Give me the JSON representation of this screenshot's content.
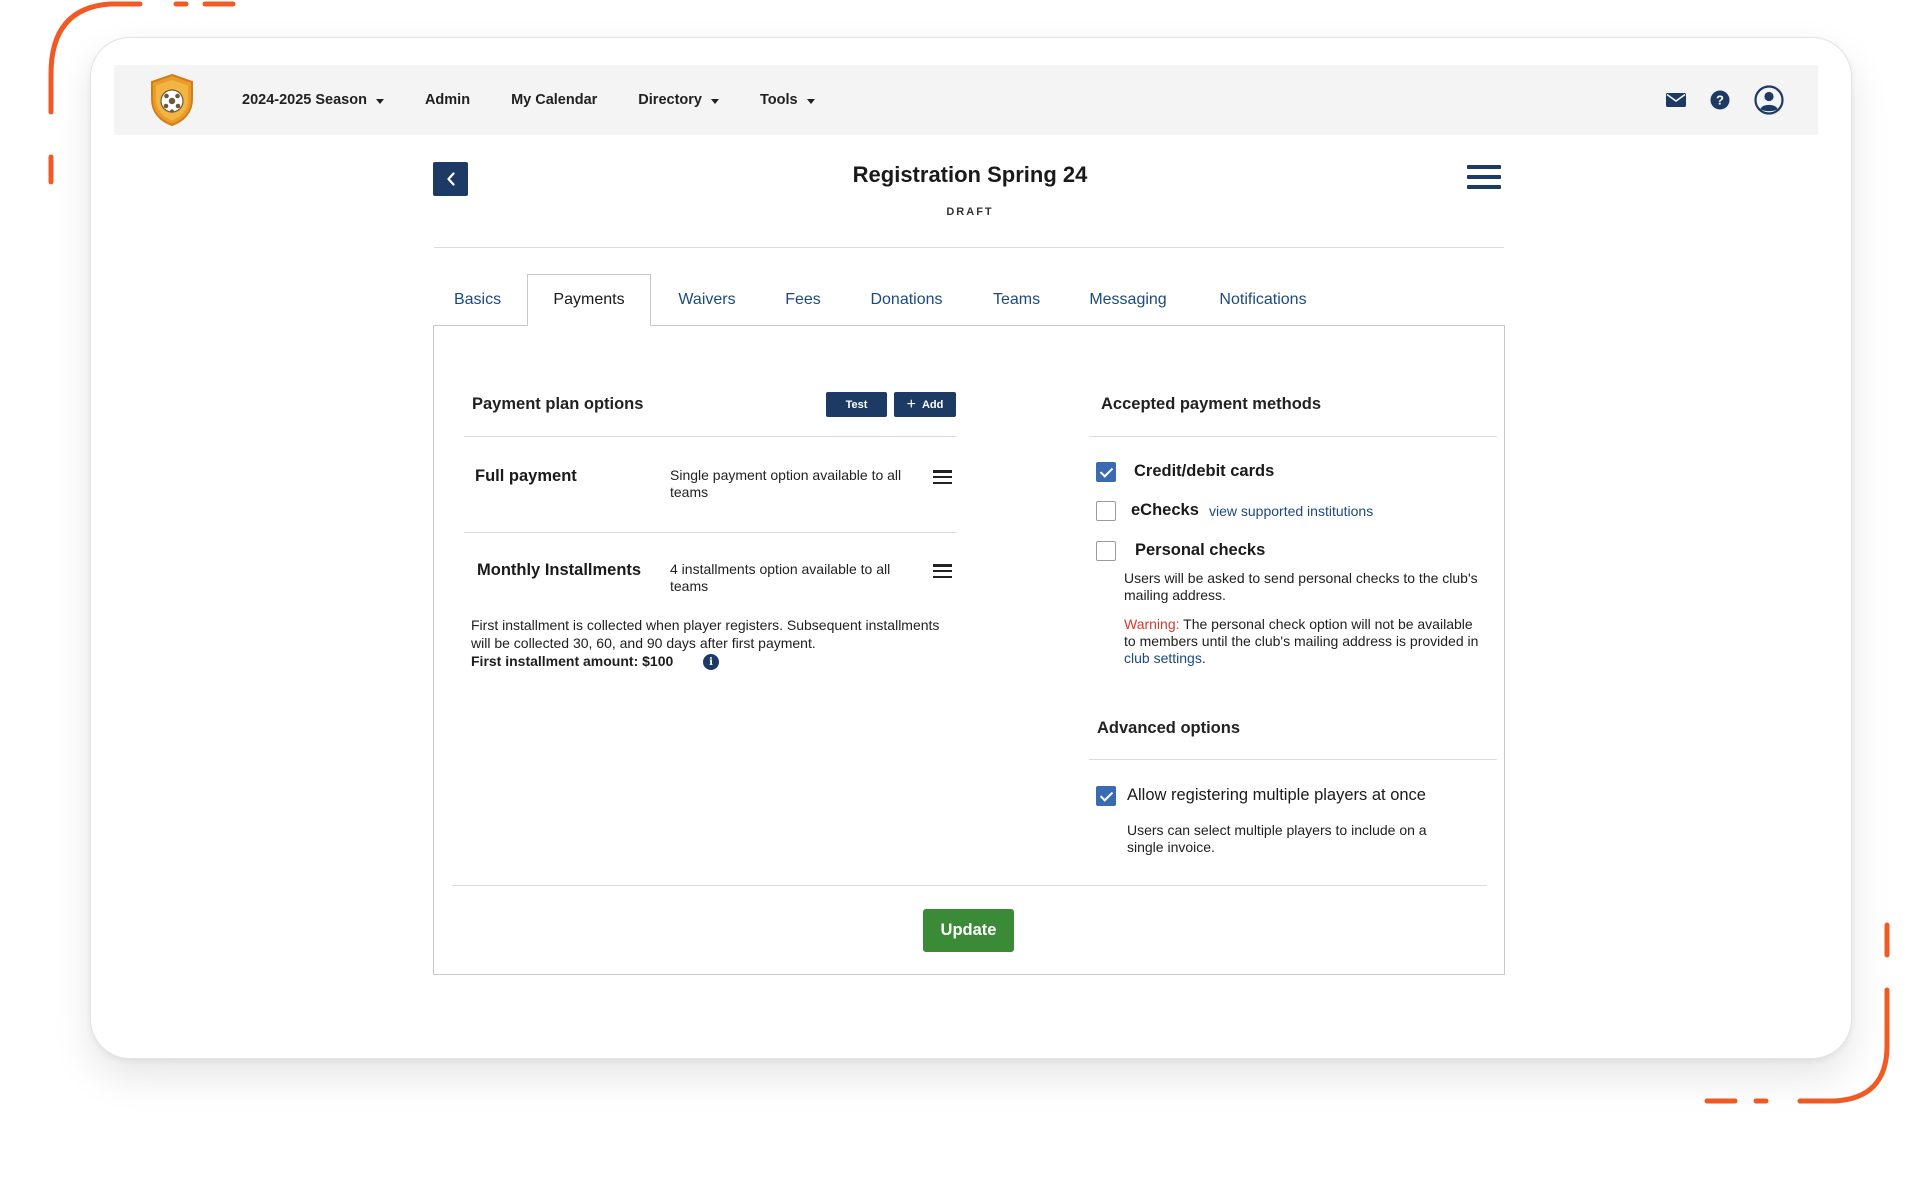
{
  "nav": {
    "logo": "club-shield-logo",
    "menu": [
      {
        "label": "2024-2025 Season",
        "dropdown": true
      },
      {
        "label": "Admin",
        "dropdown": false
      },
      {
        "label": "My Calendar",
        "dropdown": false
      },
      {
        "label": "Directory",
        "dropdown": true
      },
      {
        "label": "Tools",
        "dropdown": true
      }
    ],
    "icons": [
      "mail-icon",
      "help-icon",
      "user-account-icon"
    ]
  },
  "header": {
    "title": "Registration Spring 24",
    "status": "DRAFT"
  },
  "tabs": [
    {
      "label": "Basics",
      "active": false
    },
    {
      "label": "Payments",
      "active": true
    },
    {
      "label": "Waivers",
      "active": false
    },
    {
      "label": "Fees",
      "active": false
    },
    {
      "label": "Donations",
      "active": false
    },
    {
      "label": "Teams",
      "active": false
    },
    {
      "label": "Messaging",
      "active": false
    },
    {
      "label": "Notifications",
      "active": false
    }
  ],
  "payment_plans": {
    "title": "Payment plan options",
    "test_label": "Test",
    "add_label": "Add",
    "plans": [
      {
        "name": "Full payment",
        "description": "Single payment option available to all teams"
      },
      {
        "name": "Monthly Installments",
        "description": "4 installments option available to all teams"
      }
    ],
    "installment_note": "First installment is collected when player registers. Subsequent installments will be collected 30, 60, and 90 days after first payment.",
    "first_installment_label": "First installment amount: $100"
  },
  "payment_methods": {
    "title": "Accepted payment methods",
    "credit_label": "Credit/debit cards",
    "credit_checked": true,
    "echecks_label": "eChecks",
    "echecks_checked": false,
    "echecks_link": "view supported institutions",
    "personal_label": "Personal checks",
    "personal_checked": false,
    "personal_note": "Users will be asked to send personal checks to the club's mailing address.",
    "warning_prefix": "Warning:",
    "warning_text": " The personal check option will not be available to members until the club's mailing address is provided in ",
    "warning_link": "club settings",
    "warning_end": "."
  },
  "advanced": {
    "title": "Advanced options",
    "multi_label": "Allow registering multiple players at once",
    "multi_checked": true,
    "multi_note": "Users can select multiple players to include on a single invoice."
  },
  "footer": {
    "update_label": "Update"
  },
  "colors": {
    "navy": "#1c3a63",
    "link": "#1c4a80",
    "update_green": "#3b8a37",
    "checkbox_blue": "#3a6ab0",
    "warning_red": "#d93a2b",
    "decor_orange": "#f15a24"
  }
}
